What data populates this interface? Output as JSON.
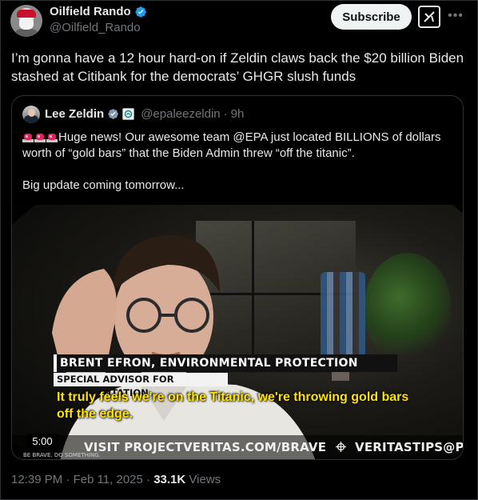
{
  "author": {
    "name": "Oilfield Rando",
    "handle": "@Oilfield_Rando"
  },
  "header": {
    "subscribe_label": "Subscribe"
  },
  "tweet": {
    "text": "I’m gonna have a 12 hour hard-on if Zeldin claws back the $20 billion Biden stashed at Citibank for the democrats’ GHGR slush funds"
  },
  "quote": {
    "name": "Lee Zeldin",
    "handle": "@epaleezeldin",
    "separator": "·",
    "age": "9h",
    "line1": "Huge news! Our awesome team @EPA just located BILLIONS of dollars worth of “gold bars” that the Biden Admin threw “off the titanic”.",
    "line2": "Big update coming tomorrow...",
    "video": {
      "lower_third_name": "BRENT EFRON, ENVIRONMENTAL PROTECTION AGENCY (EPA)",
      "lower_third_title": "SPECIAL ADVISOR FOR IMPLEMENTATION",
      "caption": "It truly feels we're on the Titanic, we're throwing gold bars off the edge.",
      "duration": "5:00",
      "brave_tag": "BE BRAVE. DO SOMETHING.",
      "visit_text": "VISIT  PROJECTVERITAS.COM/BRAVE",
      "tips_text": "VERITASTIPS@PROTONMAIL.COM"
    }
  },
  "meta": {
    "time": "12:39 PM",
    "dot": "·",
    "date": "Feb 11, 2025",
    "views_count": "33.1K",
    "views_label": "Views"
  },
  "icons": {
    "verified": "verified-badge-icon",
    "grok": "grok-icon",
    "more": "more-icon",
    "siren": "police-light-icon",
    "gov": "government-badge-icon"
  },
  "colors": {
    "background": "#000000",
    "text": "#e7e9ea",
    "muted": "#71767b",
    "verified_blue": "#1d9bf0",
    "caption_yellow": "#ffe400",
    "border": "#2f3336"
  }
}
